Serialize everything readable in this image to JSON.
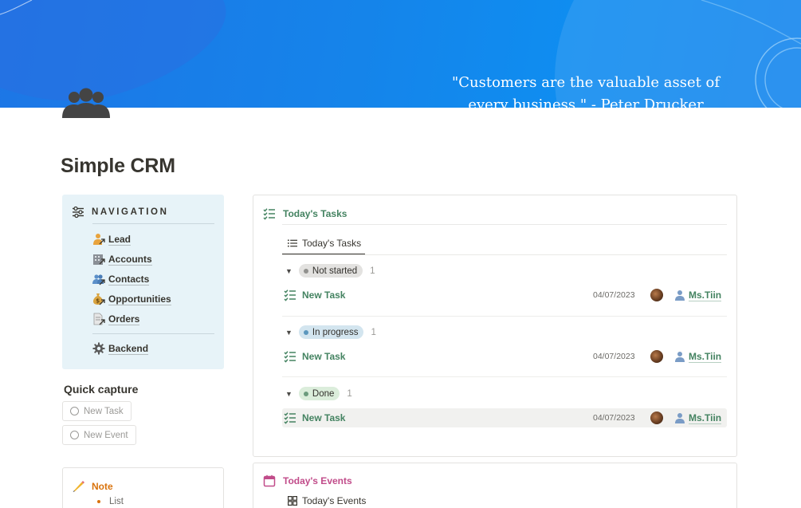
{
  "cover": {
    "quote": "\"Customers are the valuable asset of every business.\" - Peter Drucker",
    "colors": {
      "primary": "#1584ea",
      "light": "#4aa9f5"
    }
  },
  "page": {
    "icon": "people-group-icon",
    "title": "Simple CRM"
  },
  "navigation": {
    "title": "NAVIGATION",
    "icon": "sliders-icon",
    "items": [
      {
        "label": "Lead",
        "icon": "person-arrow-icon"
      },
      {
        "label": "Accounts",
        "icon": "building-arrow-icon"
      },
      {
        "label": "Contacts",
        "icon": "people-arrow-icon"
      },
      {
        "label": "Opportunities",
        "icon": "money-bag-arrow-icon"
      },
      {
        "label": "Orders",
        "icon": "document-arrow-icon"
      }
    ],
    "backend": {
      "label": "Backend",
      "icon": "gear-icon"
    },
    "background": "#e7f3f8"
  },
  "quick_capture": {
    "title": "Quick capture",
    "buttons": [
      {
        "label": "New Task",
        "icon": "circle-icon"
      },
      {
        "label": "New Event",
        "icon": "circle-icon"
      }
    ]
  },
  "note": {
    "label": "Note",
    "icon": "pencil-icon",
    "list_item": "List",
    "accent": "#d9730d"
  },
  "tasks_panel": {
    "title": "Today's Tasks",
    "icon": "checklist-icon",
    "view_tab": {
      "label": "Today's Tasks",
      "icon": "list-icon"
    },
    "groups": [
      {
        "status": "Not started",
        "count": "1",
        "pill_bg": "#e3e2e0",
        "dot": "#91918e",
        "tasks": [
          {
            "title": "New Task",
            "date": "04/07/2023",
            "assignee": "Ms.Tiin"
          }
        ]
      },
      {
        "status": "In progress",
        "count": "1",
        "pill_bg": "#d3e5ef",
        "dot": "#5b97bd",
        "tasks": [
          {
            "title": "New Task",
            "date": "04/07/2023",
            "assignee": "Ms.Tiin"
          }
        ]
      },
      {
        "status": "Done",
        "count": "1",
        "pill_bg": "#dbeddb",
        "dot": "#6c9b7d",
        "tasks": [
          {
            "title": "New Task",
            "date": "04/07/2023",
            "assignee": "Ms.Tiin"
          }
        ]
      }
    ],
    "accent": "#448361"
  },
  "events_panel": {
    "title": "Today's Events",
    "icon": "calendar-icon",
    "view_tab": {
      "label": "Today's Events",
      "icon": "gallery-icon"
    },
    "accent": "#c14c8a"
  }
}
